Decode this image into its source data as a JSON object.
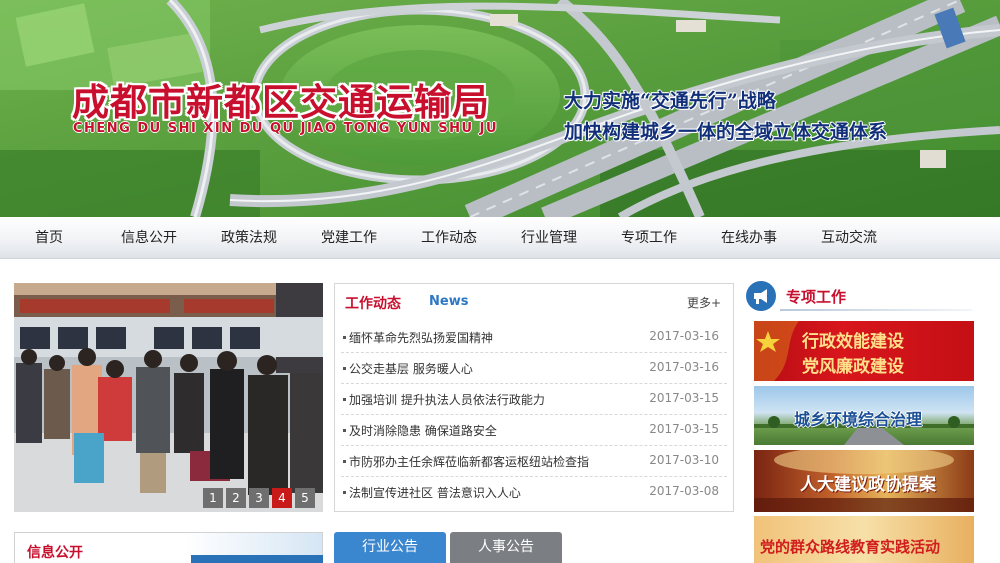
{
  "header": {
    "title": "成都市新都区交通运输局",
    "pinyin": "CHENG DU SHI XIN DU QU JIAO TONG YUN SHU JU",
    "slogan_line1": "大力实施“交通先行”战略",
    "slogan_line2": "加快构建城乡一体的全域立体交通体系"
  },
  "nav": {
    "items": [
      "首页",
      "信息公开",
      "政策法规",
      "党建工作",
      "工作动态",
      "行业管理",
      "专项工作",
      "在线办事",
      "互动交流"
    ]
  },
  "slideshow": {
    "dots": [
      "1",
      "2",
      "3",
      "4",
      "5"
    ],
    "active_index": 4
  },
  "news": {
    "title_cn": "工作动态",
    "title_en": "News",
    "more": "更多+",
    "items": [
      {
        "title": "缅怀革命先烈弘扬爱国精神",
        "date": "2017-03-16"
      },
      {
        "title": "公交走基层 服务暖人心",
        "date": "2017-03-16"
      },
      {
        "title": "加强培训 提升执法人员依法行政能力",
        "date": "2017-03-15"
      },
      {
        "title": "及时消除隐患 确保道路安全",
        "date": "2017-03-15"
      },
      {
        "title": "市防邪办主任余辉莅临新都客运枢纽站检查指",
        "date": "2017-03-10"
      },
      {
        "title": "法制宣传进社区 普法意识入人心",
        "date": "2017-03-08"
      }
    ]
  },
  "special": {
    "title": "专项工作",
    "banners": [
      {
        "line1": "行政效能建设",
        "line2": "党风廉政建设"
      },
      {
        "line1": "城乡环境综合治理"
      },
      {
        "line1": "人大建议政协提案"
      },
      {
        "line1": "党的群众路线教育实践活动"
      }
    ]
  },
  "info_public": {
    "title": "信息公开"
  },
  "tabs": [
    "行业公告",
    "人事公告"
  ],
  "colors": {
    "accent_red": "#c8102e",
    "accent_blue": "#2c78c4",
    "tab_active": "#3a86cf",
    "tab_inactive": "#7b7f84"
  }
}
